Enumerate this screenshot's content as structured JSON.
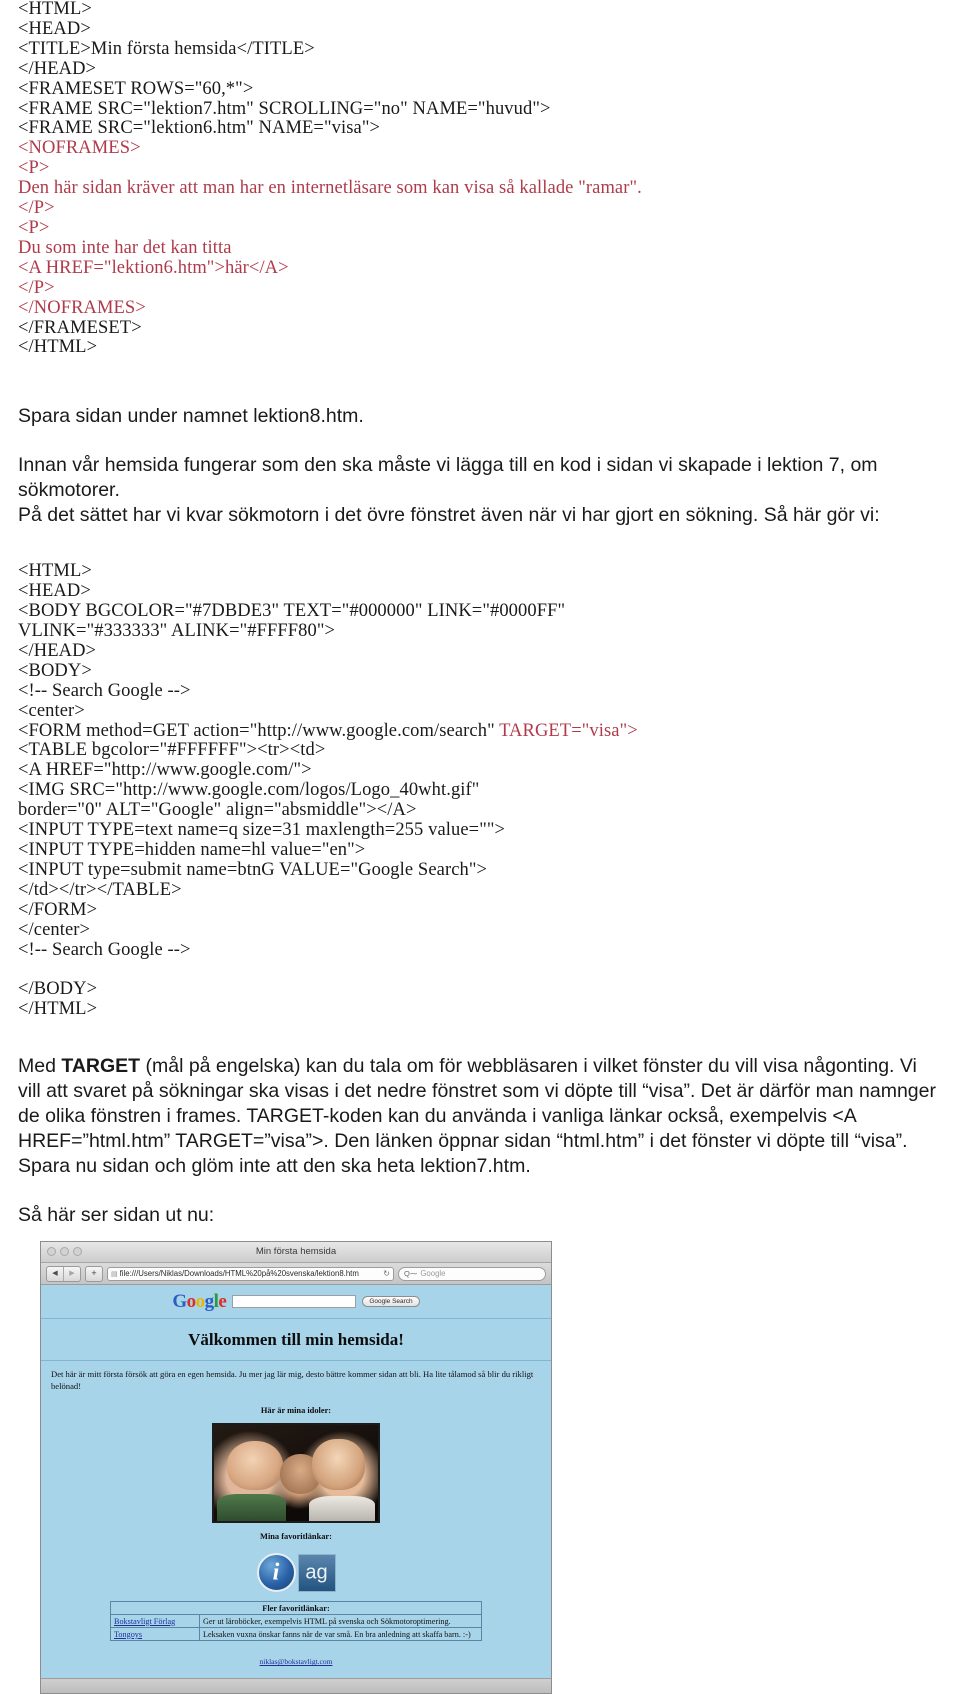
{
  "code_block_1": [
    {
      "text": "<HTML>",
      "color": "black"
    },
    {
      "text": "<HEAD>",
      "color": "black"
    },
    {
      "text": "<TITLE>Min första hemsida</TITLE>",
      "color": "black"
    },
    {
      "text": "</HEAD>",
      "color": "black"
    },
    {
      "text": "<FRAMESET ROWS=\"60,*\">",
      "color": "black"
    },
    {
      "text": "<FRAME SRC=\"lektion7.htm\" SCROLLING=\"no\" NAME=\"huvud\">",
      "color": "black"
    },
    {
      "text": "<FRAME SRC=\"lektion6.htm\" NAME=\"visa\">",
      "color": "black"
    },
    {
      "text": "<NOFRAMES>",
      "color": "red"
    },
    {
      "text": "<P>",
      "color": "red"
    },
    {
      "text": "Den här sidan kräver att man har en internetläsare som kan visa så kallade \"ramar\".",
      "color": "red"
    },
    {
      "text": "</P>",
      "color": "red"
    },
    {
      "text": "<P>",
      "color": "red"
    },
    {
      "text": "Du som inte har det kan titta",
      "color": "red"
    },
    {
      "text": "<A HREF=\"lektion6.htm\">här</A>",
      "color": "red"
    },
    {
      "text": "</P>",
      "color": "red"
    },
    {
      "text": "</NOFRAMES>",
      "color": "red"
    },
    {
      "text": "</FRAMESET>",
      "color": "black"
    },
    {
      "text": "</HTML>",
      "color": "black"
    }
  ],
  "para_save": "Spara sidan under namnet lektion8.htm.",
  "para_intro_line1": "Innan vår hemsida fungerar som den ska måste vi lägga till en kod i sidan vi skapade i lektion 7, om sökmotorer.",
  "para_intro_line2": "På det sättet har vi kvar sökmotorn i det övre fönstret även när vi har gjort en sökning. Så här gör vi:",
  "code_block_2": [
    {
      "text": "<HTML>",
      "color": "black"
    },
    {
      "text": "<HEAD>",
      "color": "black"
    },
    {
      "text": "<BODY BGCOLOR=\"#7DBDE3\" TEXT=\"#000000\" LINK=\"#0000FF\"",
      "color": "black"
    },
    {
      "text": "VLINK=\"#333333\" ALINK=\"#FFFF80\">",
      "color": "black"
    },
    {
      "text": "</HEAD>",
      "color": "black"
    },
    {
      "text": "<BODY>",
      "color": "black"
    },
    {
      "text": "<!-- Search Google -->",
      "color": "black"
    },
    {
      "text": "<center>",
      "color": "black"
    },
    {
      "text": "<FORM method=GET action=\"http://www.google.com/search\" ",
      "red_suffix": "TARGET=\"visa\">",
      "color": "mixed"
    },
    {
      "text": "<TABLE bgcolor=\"#FFFFFF\"><tr><td>",
      "color": "black"
    },
    {
      "text": "<A HREF=\"http://www.google.com/\">",
      "color": "black"
    },
    {
      "text": "<IMG SRC=\"http://www.google.com/logos/Logo_40wht.gif\"",
      "color": "black"
    },
    {
      "text": "border=\"0\" ALT=\"Google\" align=\"absmiddle\"></A>",
      "color": "black"
    },
    {
      "text": "<INPUT TYPE=text name=q size=31 maxlength=255 value=\"\">",
      "color": "black"
    },
    {
      "text": "<INPUT TYPE=hidden name=hl value=\"en\">",
      "color": "black"
    },
    {
      "text": "<INPUT type=submit name=btnG VALUE=\"Google Search\">",
      "color": "black"
    },
    {
      "text": "</td></tr></TABLE>",
      "color": "black"
    },
    {
      "text": "</FORM>",
      "color": "black"
    },
    {
      "text": "</center>",
      "color": "black"
    },
    {
      "text": "<!-- Search Google -->",
      "color": "black"
    },
    {
      "text": "",
      "color": "black"
    },
    {
      "text": "</BODY>",
      "color": "black"
    },
    {
      "text": "</HTML>",
      "color": "black"
    }
  ],
  "para_target": {
    "lead": "Med ",
    "bold": "TARGET",
    "rest": " (mål på engelska) kan du tala om för webbläsaren i vilket fönster du vill visa någonting. Vi vill att svaret på sökningar ska visas i det nedre fönstret som vi döpte till “visa”. Det är därför man namnger de olika fönstren i frames. TARGET-koden kan du använda i vanliga länkar också, exempelvis <A HREF=”html.htm” TARGET=”visa”>. Den länken öppnar sidan “html.htm” i det fönster vi döpte till “visa”. Spara nu sidan och glöm inte att den ska heta lektion7.htm."
  },
  "para_preview": "Så här ser sidan ut nu:",
  "browser": {
    "window_title": "Min första hemsida",
    "back_icon": "◀",
    "forward_icon": "▶",
    "add_label": "+",
    "favicon": "▤",
    "url": "file:///Users/Niklas/Downloads/HTML%20på%20svenska/lektion8.htm",
    "reload_icon": "↻",
    "search_icon": "Q⁓",
    "search_placeholder": "Google",
    "google_logo": [
      {
        "ch": "G",
        "cls": "b"
      },
      {
        "ch": "o",
        "cls": "r"
      },
      {
        "ch": "o",
        "cls": "y"
      },
      {
        "ch": "g",
        "cls": "b"
      },
      {
        "ch": "l",
        "cls": "g"
      },
      {
        "ch": "e",
        "cls": "r"
      }
    ],
    "google_search_button": "Google Search",
    "welcome_heading": "Välkommen till min hemsida!",
    "intro_text": "Det här är mitt första försök att göra en egen hemsida. Ju mer jag lär mig, desto bättre kommer sidan att bli. Ha lite tålamod så blir du rikligt belönad!",
    "idols_heading": "Här är mina idoler:",
    "favlinks_heading": "Mina favoritlänkar:",
    "table": {
      "caption": "Fler favoritlänkar:",
      "rows": [
        {
          "link": "Bokstavligt Förlag",
          "desc": "Ger ut läroböcker, exempelvis HTML på svenska och Sökmotoroptimering."
        },
        {
          "link": "Tongoys",
          "desc": "Leksaken vuxna önskar fanns när de var små. En bra anledning att skaffa barn. :-)"
        }
      ]
    },
    "email": "niklas@bokstavligt.com"
  },
  "colors": {
    "code_red": "#b03a4a",
    "page_bg": "#7DBDE3",
    "link_blue": "#1c2f9c"
  }
}
